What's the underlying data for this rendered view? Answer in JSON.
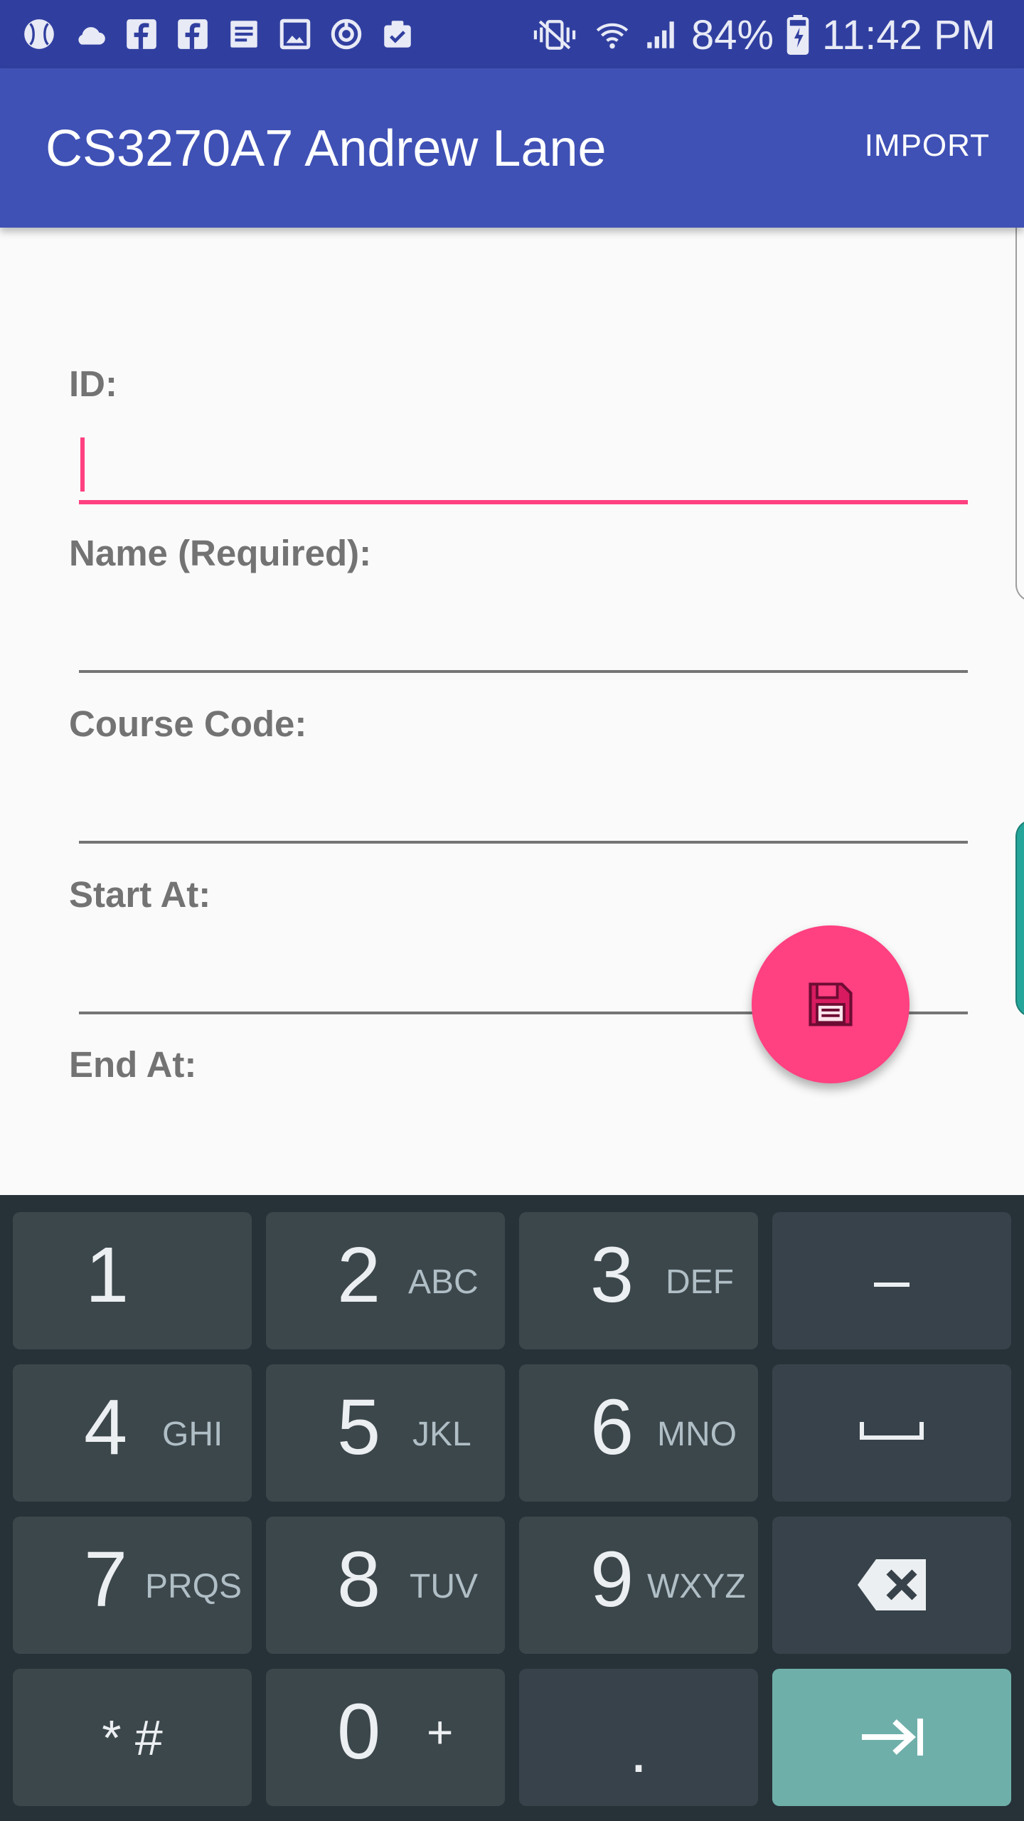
{
  "status_bar": {
    "battery": "84%",
    "time": "11:42 PM",
    "left_icons": [
      "baseball-icon",
      "cloud-icon",
      "facebook-icon",
      "facebook-icon",
      "document-icon",
      "image-icon",
      "refresh-icon",
      "clipboard-check-icon"
    ],
    "right_icons": [
      "vibrate-icon",
      "wifi-icon",
      "signal-icon",
      "battery-charging-icon"
    ]
  },
  "app_bar": {
    "title": "CS3270A7 Andrew Lane",
    "import_label": "IMPORT"
  },
  "form": {
    "fields": [
      {
        "label": "ID:",
        "value": "",
        "focused": true
      },
      {
        "label": "Name (Required):",
        "value": ""
      },
      {
        "label": "Course Code:",
        "value": ""
      },
      {
        "label": "Start At:",
        "value": ""
      },
      {
        "label": "End At:",
        "value": ""
      }
    ]
  },
  "fab": {
    "icon": "save-icon"
  },
  "keyboard": {
    "keys": [
      {
        "digit": "1",
        "letters": ""
      },
      {
        "digit": "2",
        "letters": "ABC"
      },
      {
        "digit": "3",
        "letters": "DEF"
      },
      {
        "symbol": "–"
      },
      {
        "digit": "4",
        "letters": "GHI"
      },
      {
        "digit": "5",
        "letters": "JKL"
      },
      {
        "digit": "6",
        "letters": "MNO"
      },
      {
        "symbol": "␣"
      },
      {
        "digit": "7",
        "letters": "PRQS"
      },
      {
        "digit": "8",
        "letters": "TUV"
      },
      {
        "digit": "9",
        "letters": "WXYZ"
      },
      {
        "icon": "backspace-icon"
      },
      {
        "symbol": "* #"
      },
      {
        "digit": "0",
        "letters": "+"
      },
      {
        "symbol": "."
      },
      {
        "icon": "next-tab-icon"
      }
    ]
  },
  "colors": {
    "status_bar": "#303f9f",
    "app_bar": "#3f51b5",
    "accent": "#ff4081",
    "keyboard_bg": "#263238",
    "key_bg": "#3c474c",
    "action_key": "#6fafaa"
  }
}
